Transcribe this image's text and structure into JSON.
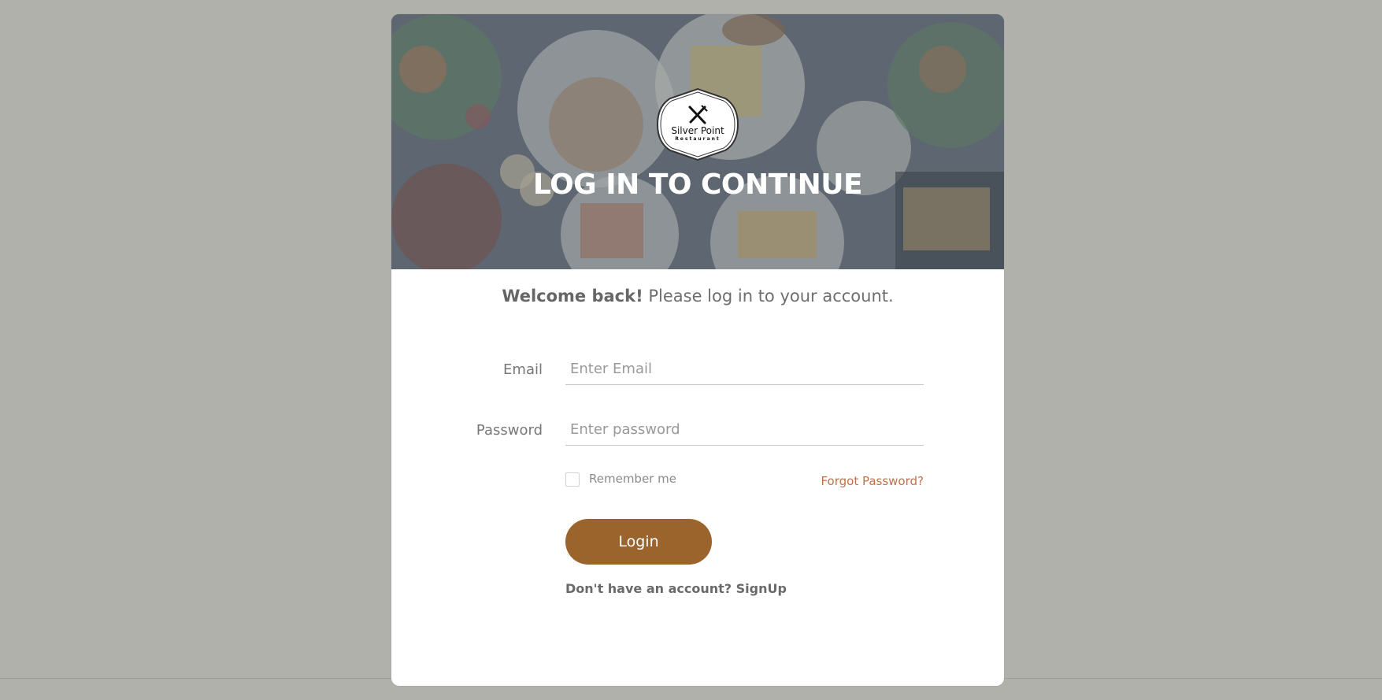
{
  "colors": {
    "page_background": "#b0b1aa",
    "card_background": "#ffffff",
    "accent_button": "#9c642d",
    "forgot_link": "#c0714a"
  },
  "logo": {
    "name": "Silver Point",
    "sub": "Restaurant",
    "icon": "crossed-utensils-icon"
  },
  "hero": {
    "title": "LOG IN TO CONTINUE"
  },
  "welcome": {
    "bold": "Welcome back!",
    "rest": " Please log in to your account."
  },
  "form": {
    "email_label": "Email",
    "email_placeholder": "Enter Email",
    "email_value": "",
    "password_label": "Password",
    "password_placeholder": "Enter password",
    "password_value": "",
    "remember_label": "Remember me",
    "remember_checked": false,
    "forgot_label": "Forgot Password?",
    "login_label": "Login",
    "signup_prompt": "Don't have an account? ",
    "signup_label": "SignUp"
  }
}
